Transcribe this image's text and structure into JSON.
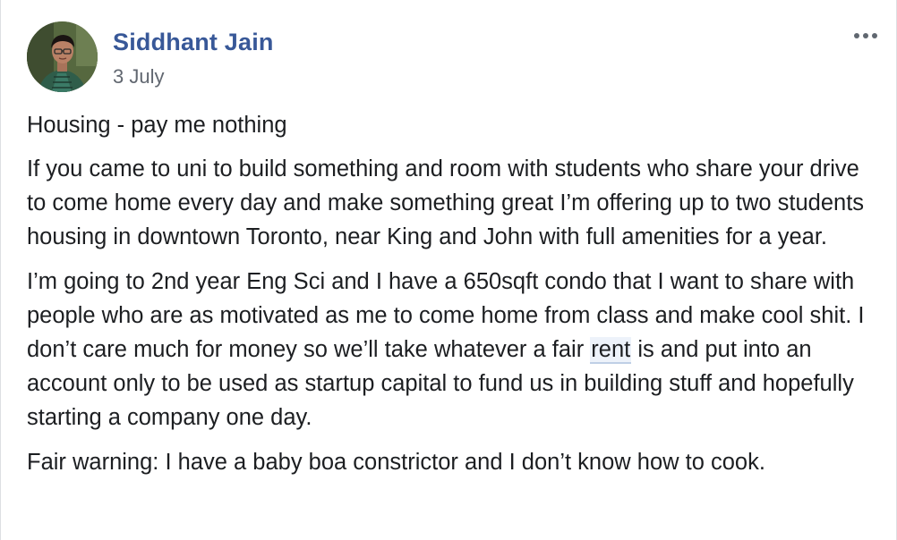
{
  "post": {
    "author": "Siddhant Jain",
    "date": "3 July",
    "paragraphs": {
      "p1": "Housing - pay me nothing",
      "p2": "If you came to uni to build something and room with students who share your drive to come home every day and make something great I’m offering up to two students housing in downtown Toronto, near King and John with full amenities for a year.",
      "p3_before": "I’m going to 2nd year Eng Sci and I have a 650sqft condo that I want to share with people who are as motivated as me to come home from class and make cool shit. I don’t care much for money so we’ll take whatever a fair ",
      "p3_highlight": "rent",
      "p3_after": " is and put into an account only to be used as startup capital to fund us in building stuff and hopefully starting a company one day.",
      "p4": "Fair warning: I have a baby boa constrictor and I don’t know how to cook."
    }
  },
  "icons": {
    "more": "more-options-icon",
    "avatar": "profile-photo"
  },
  "colors": {
    "author": "#385898",
    "date": "#616770",
    "text": "#1c1e21",
    "highlight": "#edf2fa"
  }
}
